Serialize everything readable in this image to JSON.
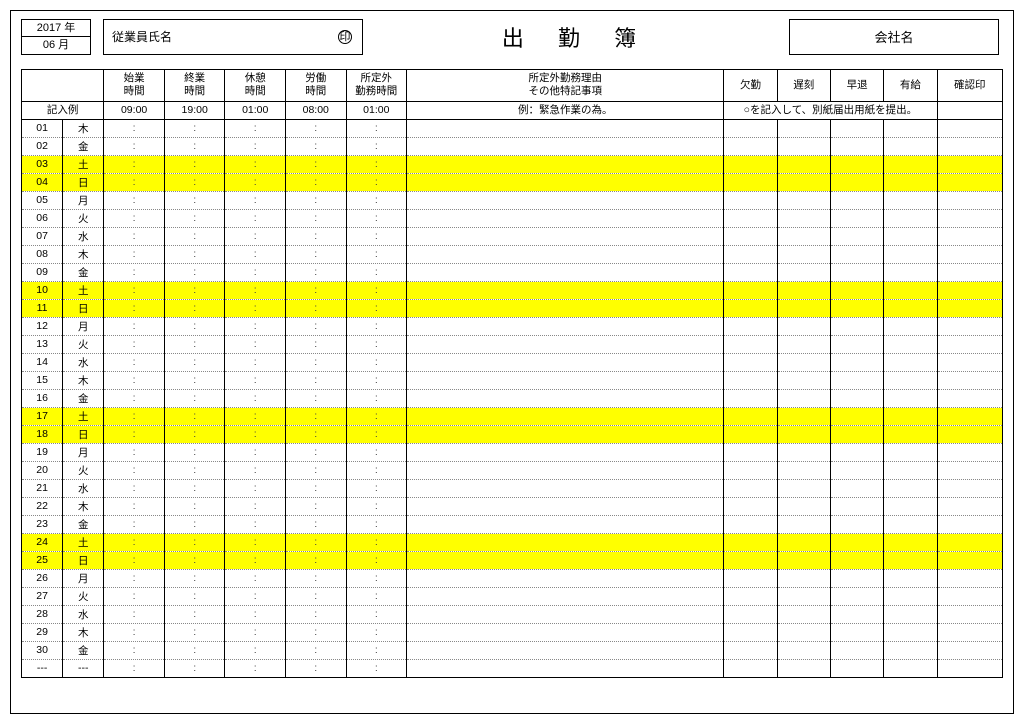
{
  "header": {
    "year_label": "2017 年",
    "month_label": "06 月",
    "employee_label": "従業員氏名",
    "stamp_mark": "印",
    "title": "出 勤 簿",
    "company_label": "会社名"
  },
  "columns": {
    "day": "",
    "dow": "",
    "start": "始業\n時間",
    "end": "終業\n時間",
    "break": "休憩\n時間",
    "work": "労働\n時間",
    "overtime": "所定外\n勤務時間",
    "reason": "所定外勤務理由\nその他特記事項",
    "absent": "欠勤",
    "late": "遅刻",
    "early": "早退",
    "paid": "有給",
    "confirm": "確認印"
  },
  "example_row": {
    "label": "記入例",
    "start": "09:00",
    "end": "19:00",
    "break": "01:00",
    "work": "08:00",
    "overtime": "01:00",
    "reason": "例：緊急作業の為。",
    "note": "○を記入して、別紙届出用紙を提出。"
  },
  "days": [
    {
      "d": "01",
      "w": "木",
      "we": false
    },
    {
      "d": "02",
      "w": "金",
      "we": false
    },
    {
      "d": "03",
      "w": "土",
      "we": true
    },
    {
      "d": "04",
      "w": "日",
      "we": true
    },
    {
      "d": "05",
      "w": "月",
      "we": false
    },
    {
      "d": "06",
      "w": "火",
      "we": false
    },
    {
      "d": "07",
      "w": "水",
      "we": false
    },
    {
      "d": "08",
      "w": "木",
      "we": false
    },
    {
      "d": "09",
      "w": "金",
      "we": false
    },
    {
      "d": "10",
      "w": "土",
      "we": true
    },
    {
      "d": "11",
      "w": "日",
      "we": true
    },
    {
      "d": "12",
      "w": "月",
      "we": false
    },
    {
      "d": "13",
      "w": "火",
      "we": false
    },
    {
      "d": "14",
      "w": "水",
      "we": false
    },
    {
      "d": "15",
      "w": "木",
      "we": false
    },
    {
      "d": "16",
      "w": "金",
      "we": false
    },
    {
      "d": "17",
      "w": "土",
      "we": true
    },
    {
      "d": "18",
      "w": "日",
      "we": true
    },
    {
      "d": "19",
      "w": "月",
      "we": false
    },
    {
      "d": "20",
      "w": "火",
      "we": false
    },
    {
      "d": "21",
      "w": "水",
      "we": false
    },
    {
      "d": "22",
      "w": "木",
      "we": false
    },
    {
      "d": "23",
      "w": "金",
      "we": false
    },
    {
      "d": "24",
      "w": "土",
      "we": true
    },
    {
      "d": "25",
      "w": "日",
      "we": true
    },
    {
      "d": "26",
      "w": "月",
      "we": false
    },
    {
      "d": "27",
      "w": "火",
      "we": false
    },
    {
      "d": "28",
      "w": "水",
      "we": false
    },
    {
      "d": "29",
      "w": "木",
      "we": false
    },
    {
      "d": "30",
      "w": "金",
      "we": false
    },
    {
      "d": "---",
      "w": "---",
      "we": false
    }
  ],
  "cell_placeholder": ":"
}
